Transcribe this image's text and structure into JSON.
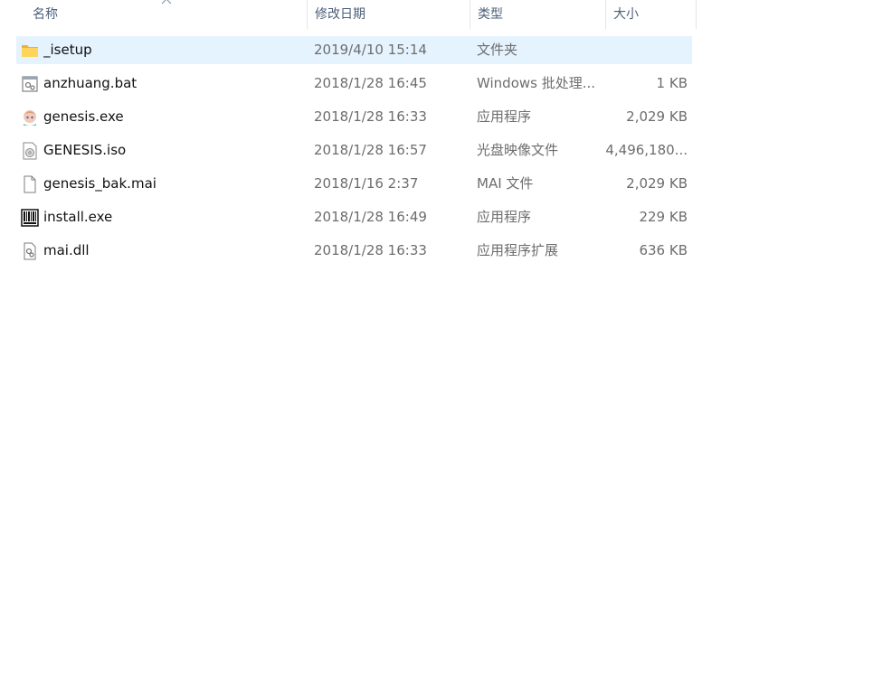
{
  "columns": {
    "name": "名称",
    "date": "修改日期",
    "type": "类型",
    "size": "大小"
  },
  "files": [
    {
      "name": "_isetup",
      "date": "2019/4/10 15:14",
      "type": "文件夹",
      "size": "",
      "icon": "folder-icon",
      "selected": true
    },
    {
      "name": "anzhuang.bat",
      "date": "2018/1/28 16:45",
      "type": "Windows 批处理...",
      "size": "1 KB",
      "icon": "batch-file-icon"
    },
    {
      "name": "genesis.exe",
      "date": "2018/1/28 16:33",
      "type": "应用程序",
      "size": "2,029 KB",
      "icon": "genesis-app-icon"
    },
    {
      "name": "GENESIS.iso",
      "date": "2018/1/28 16:57",
      "type": "光盘映像文件",
      "size": "4,496,180...",
      "icon": "disc-image-icon"
    },
    {
      "name": "genesis_bak.mai",
      "date": "2018/1/16 2:37",
      "type": "MAI 文件",
      "size": "2,029 KB",
      "icon": "blank-file-icon"
    },
    {
      "name": "install.exe",
      "date": "2018/1/28 16:49",
      "type": "应用程序",
      "size": "229 KB",
      "icon": "installer-icon"
    },
    {
      "name": "mai.dll",
      "date": "2018/1/28 16:33",
      "type": "应用程序扩展",
      "size": "636 KB",
      "icon": "dll-file-icon"
    }
  ],
  "colors": {
    "selection": "#e5f3ff",
    "header_text": "#4c607a",
    "folder": "#ffd45a"
  }
}
